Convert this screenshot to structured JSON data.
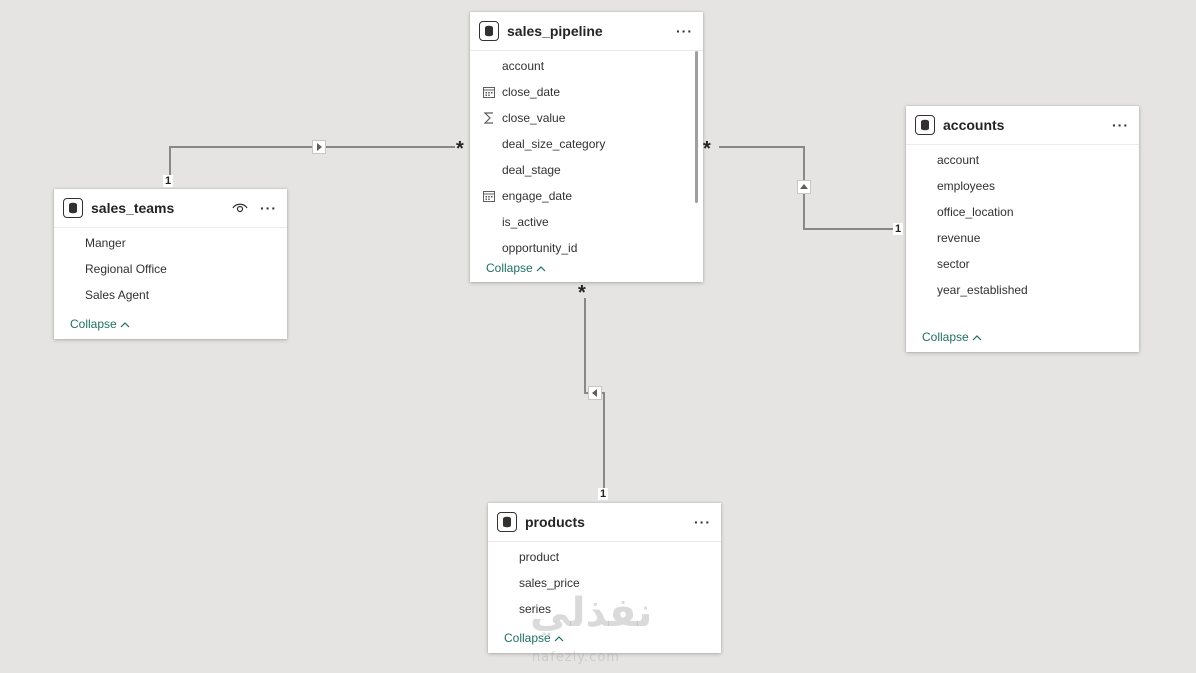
{
  "tables": {
    "sales_pipeline": {
      "title": "sales_pipeline",
      "more": "···",
      "fields": [
        {
          "name": "account",
          "icon": "none"
        },
        {
          "name": "close_date",
          "icon": "calendar-icon"
        },
        {
          "name": "close_value",
          "icon": "sigma-icon"
        },
        {
          "name": "deal_size_category",
          "icon": "none"
        },
        {
          "name": "deal_stage",
          "icon": "none"
        },
        {
          "name": "engage_date",
          "icon": "calendar-icon"
        },
        {
          "name": "is_active",
          "icon": "none"
        },
        {
          "name": "opportunity_id",
          "icon": "none"
        }
      ],
      "collapse": "Collapse"
    },
    "sales_teams": {
      "title": "sales_teams",
      "more": "···",
      "fields": [
        {
          "name": "Manger"
        },
        {
          "name": "Regional Office"
        },
        {
          "name": "Sales Agent"
        }
      ],
      "collapse": "Collapse"
    },
    "accounts": {
      "title": "accounts",
      "more": "···",
      "fields": [
        {
          "name": "account"
        },
        {
          "name": "employees"
        },
        {
          "name": "office_location"
        },
        {
          "name": "revenue"
        },
        {
          "name": "sector"
        },
        {
          "name": "year_established"
        }
      ],
      "collapse": "Collapse"
    },
    "products": {
      "title": "products",
      "more": "···",
      "fields": [
        {
          "name": "product"
        },
        {
          "name": "sales_price"
        },
        {
          "name": "series"
        }
      ],
      "collapse": "Collapse"
    }
  },
  "relationships": {
    "one": "1",
    "many": "*"
  },
  "watermark": {
    "text": "نفذلي",
    "sub": "nafezly.com"
  },
  "colors": {
    "background": "#e5e4e2",
    "collapse_link": "#1f6f63",
    "connector": "#8a8886"
  }
}
